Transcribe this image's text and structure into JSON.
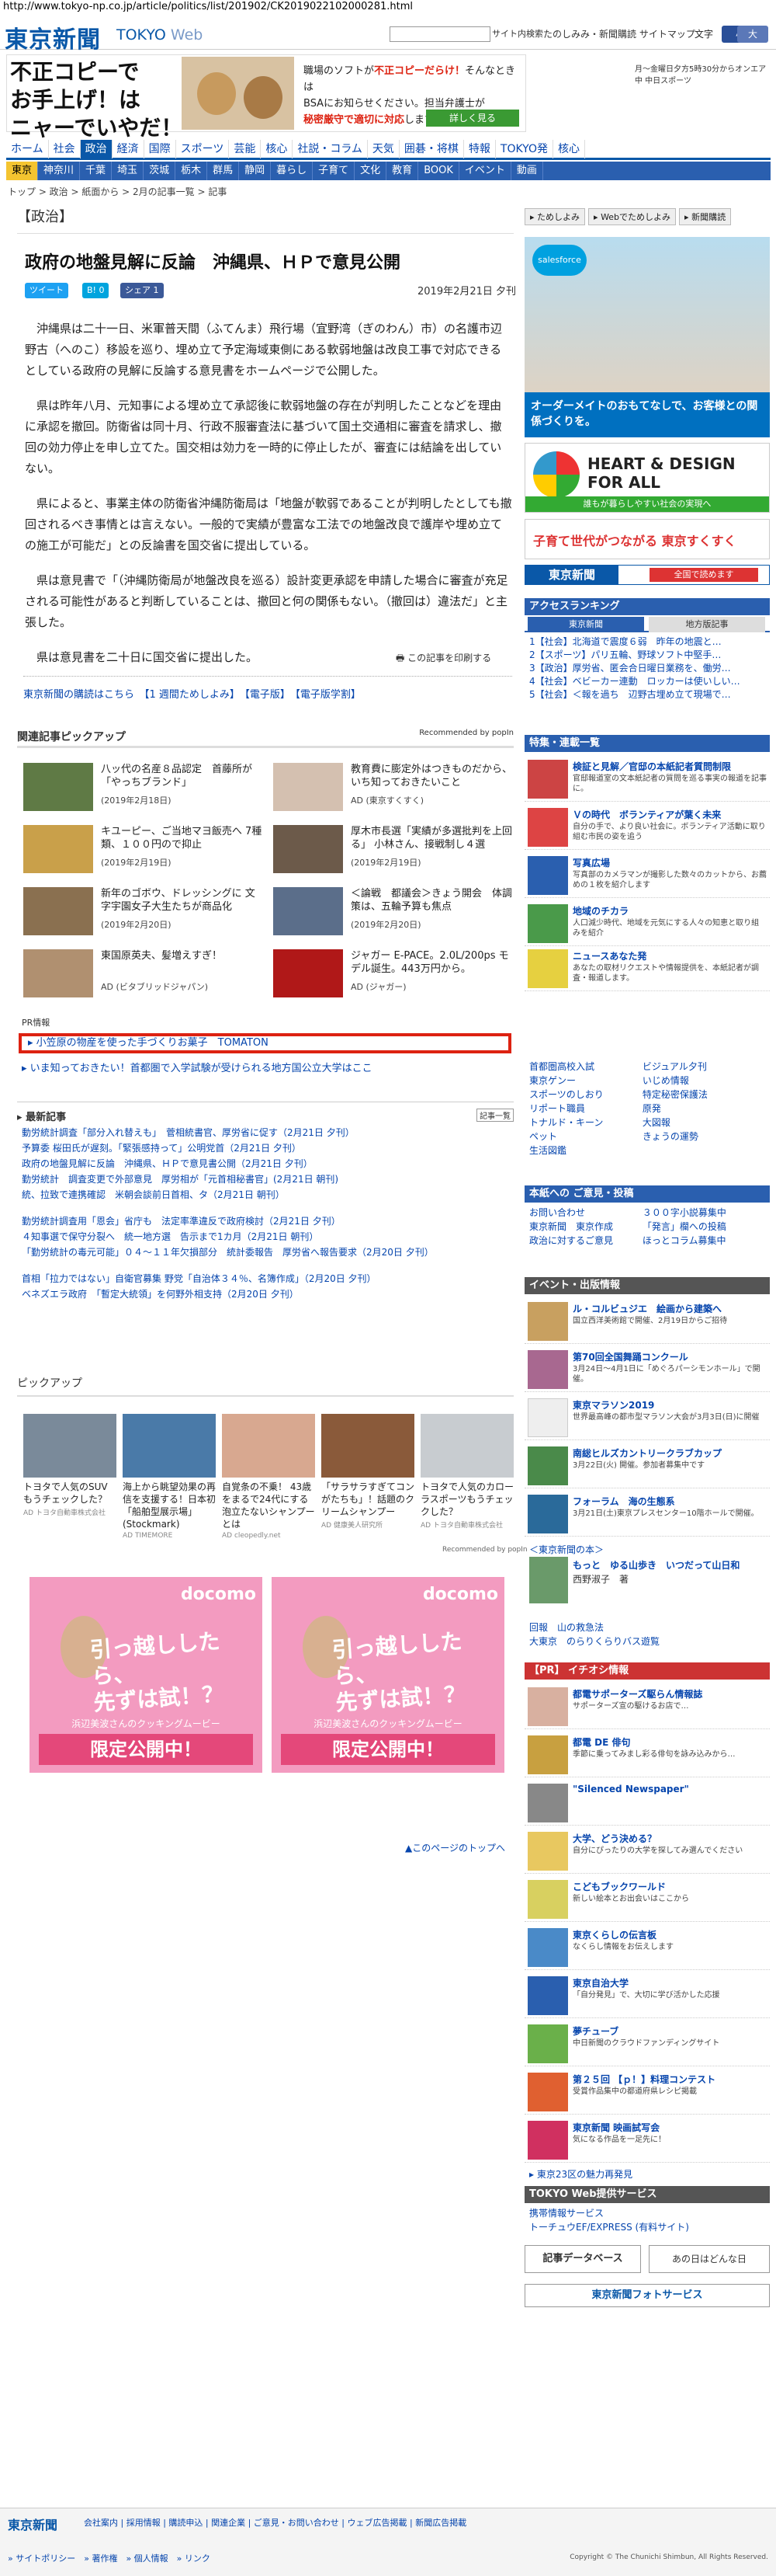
{
  "url": "http://www.tokyo-np.co.jp/article/politics/list/201902/CK2019022102000281.html",
  "header": {
    "logo": "東京新聞",
    "logo_sub": "TOKYO",
    "logo_web": "Web",
    "search_btn": "サイト内検索",
    "links": "たのしみみ・新聞購読 サイトマップ",
    "font": "文字",
    "font_small": "小",
    "font_big": "大"
  },
  "ad_top": {
    "headline1": "不正コピーで",
    "headline2": "お手上げ！は",
    "headline3": "ニャーでいやだ！",
    "text1": "職場のソフトが",
    "text_red": "不正コピーだらけ！",
    "text2": "そんなときは",
    "text3": "BSAにお知らせください。担当弁護士が",
    "text_red2": "秘密厳守で適切に対応",
    "text4": "します。",
    "btn": "詳しく見る",
    "banner": "月〜金曜日夕方5時30分からオンエア中 中日スポーツ"
  },
  "nav1": [
    "ホーム",
    "社会",
    "政治",
    "経済",
    "国際",
    "スポーツ",
    "芸能",
    "核心",
    "社説・コラム",
    "天気",
    "囲碁・将棋",
    "特報",
    "TOKYO発",
    "核心"
  ],
  "nav2": [
    "東京",
    "神奈川",
    "千葉",
    "埼玉",
    "茨城",
    "栃木",
    "群馬",
    "静岡",
    "暮らし",
    "子育て",
    "文化",
    "教育",
    "BOOK",
    "イベント",
    "動画"
  ],
  "breadcrumb": "トップ > 政治 > 紙面から > 2月の記事一覧 > 記事",
  "section": "【政治】",
  "article": {
    "title": "政府の地盤見解に反論　沖縄県、ＨＰで意見公開",
    "date": "2019年2月21日 夕刊",
    "tweet": "ツイート",
    "hatena": "0",
    "fb": "シェア 1",
    "p1": "沖縄県は二十一日、米軍普天間（ふてんま）飛行場（宜野湾（ぎのわん）市）の名護市辺野古（へのこ）移設を巡り、埋め立て予定海域東側にある軟弱地盤は改良工事で対応できるとしている政府の見解に反論する意見書をホームページで公開した。",
    "p2": "県は昨年八月、元知事による埋め立て承認後に軟弱地盤の存在が判明したことなどを理由に承認を撤回。防衛省は同十月、行政不服審査法に基づいて国土交通相に審査を請求し、撤回の効力停止を申し立てた。国交相は効力を一時的に停止したが、審査には結論を出していない。",
    "p3": "県によると、事業主体の防衛省沖縄防衛局は「地盤が軟弱であることが判明したとしても撤回されるべき事情とは言えない。一般的で実績が豊富な工法での地盤改良で護岸や埋め立ての施工が可能だ」との反論書を国交省に提出している。",
    "p4": "県は意見書で「（沖縄防衛局が地盤改良を巡る）設計変更承認を申請した場合に審査が充足される可能性があると判断していることは、撤回と何の関係もない。（撤回は）違法だ」と主張した。",
    "p5": "県は意見書を二十日に国交省に提出した。",
    "print": "この記事を印刷する"
  },
  "tags": "東京新聞の購読はこちら　【1 週間ためしよみ】　【電子版】　【電子版学割】",
  "related": {
    "title": "関連記事ピックアップ",
    "rec": "Recommended by popIn",
    "items": [
      {
        "t": "八ッ代の名産８品認定　首藤所が「やっちブランド」",
        "d": "(2019年2月18日)"
      },
      {
        "t": "教育費に膨定外はつきものだから、いち知っておきたいこと",
        "d": "AD (東京すくすく)"
      },
      {
        "t": "キユーピー、ご当地マヨ飯売へ 7種類、１００円ので抑止",
        "d": "(2019年2月19日)"
      },
      {
        "t": "厚木市長選「実績が多選批判を上回る」 小林さん、接戦制し４選",
        "d": "(2019年2月19日)"
      },
      {
        "t": "新年のゴボウ、ドレッシングに  文字宇園女子大生たちが商品化",
        "d": "(2019年2月20日)"
      },
      {
        "t": "＜論戦　都議会＞きょう開会　体調策は、五輪予算も焦点",
        "d": "(2019年2月20日)"
      },
      {
        "t": "東国原英夫、髪増えすぎ！",
        "d": "AD (ビタブリッドジャパン)"
      },
      {
        "t": "ジャガー E-PACE。2.0L/200ps モデル誕生。443万円から。",
        "d": "AD (ジャガー)"
      }
    ]
  },
  "pr": {
    "tag": "PR情報",
    "item1": "小笠原の物産を使った手づくりお菓子　TOMATON",
    "item2": "いま知っておきたい！首都圏で入学試験が受けられる地方国公立大学はここ"
  },
  "latest": {
    "title": "最新記事",
    "kiji": "記事一覧",
    "items": [
      "動労統計調査「部分入れ替えも」　菅相統書官、厚労省に促す（2月21日 夕刊）",
      "予算委 桜田氏が遅刻。「緊張感持って」公明党首（2月21日 夕刊）",
      "政府の地盤見解に反論　沖縄県、ＨＰで意見書公開（2月21日 夕刊）",
      "勤労統計　調査変更で外部意見　厚労相が「元首相秘書官」(2月21日 朝刊)",
      "統、拉致で連携確認　米朝会談前日首相、タ（2月21日 朝刊）",
      "",
      "勤労統計調査用「恩会」省庁も　法定率準違反で政府検討（2月21日 夕刊）",
      "４知事選で保守分裂へ　統一地方選　告示まで1カ月（2月21日 朝刊）",
      "「勤労統計の毒元可能」０４〜１１年欠損部分　統計委報告　厚労省へ報告要求（2月20日 夕刊）",
      "",
      "首相「拉力ではない」自衛官募集 野党「自治体３４％、名簿作成」（2月20日 夕刊）",
      "ベネズエラ政府　「暫定大統領」を何野外相支持（2月20日 夕刊）"
    ]
  },
  "pickup": {
    "title": "ピックアップ",
    "items": [
      {
        "t": "トヨタで人気のSUVもうチェックした？",
        "s": "AD トヨタ自動車株式会社"
      },
      {
        "t": "海上から眺望効果の再信を支援する！日本初「船舶型展示場」(Stockmark)",
        "s": "AD TIMEMORE"
      },
      {
        "t": "自覚条の不乗！ 43歳をまるで24代にする泡立たないシャンプーとは",
        "s": "AD cleopedly.net"
      },
      {
        "t": "「サラサラすぎてコンがたちも」！話題のクリームシャンプー",
        "s": "AD 健康美人研究所"
      },
      {
        "t": "トヨタで人気のカローラスポーツもうチェックした？",
        "s": "AD トヨタ自動車株式会社"
      }
    ],
    "rec": "Recommended by popIn"
  },
  "docomo": {
    "brand": "docomo",
    "big1": "引っ越ししたら、",
    "big2": "先ずは試！？",
    "sub": "浜辺美波さんのクッキングムービー",
    "btn": "限定公開中！"
  },
  "totop": "このページのトップへ",
  "side": {
    "btns": [
      "ためしよみ",
      "Webでためしよみ",
      "新聞購読"
    ],
    "ad1_label": "salesforce",
    "ad1_text": "オーダーメイトのおもてなしで、お客様との関係づくりを。",
    "heart": "HEART & DESIGN FOR ALL",
    "heart_sub": "誰もが暮らしやすい社会の実現へ",
    "suku": "子育て世代がつながる 東京すくすく",
    "shimbun": "東京新聞",
    "shimbun_btn": "全国で読めます",
    "access": "アクセスランキング",
    "tab1": "東京新聞",
    "tab2": "地方版記事",
    "rank": [
      "1【社会】北海道で震度６弱　昨年の地震と…",
      "2【スポーツ】パリ五輪、野球ソフト中堅手…",
      "3【政治】厚労省、匿会合日曜日業務を、働労…",
      "4【社会】ベビーカー連動　ロッカーは使いしい…",
      "5【社会】＜報を過ち　辺野古埋め立て現場で…"
    ],
    "special": "特集・連載一覧",
    "sitems": [
      {
        "t": "検証と見解／官邸の本紙記者質問制限",
        "d": "官邸報道室の文本紙記者の質問を巡る事実の報道を記事に。"
      },
      {
        "t": "Ｖの時代　ボランティアが葉く未来",
        "d": "自分の手で、より良い社会に。ボランティア活動に取り組む市民の姿を追う"
      },
      {
        "t": "写真広場",
        "d": "写真部のカメラマンが撮影した数々のカットから、お薦めの１枚を紹介します"
      },
      {
        "t": "地域のチカラ",
        "d": "人口減少時代、地域を元気にする人々の知恵と取り組みを紹介"
      },
      {
        "t": "ニュースあなた発",
        "d": "あなたの取材リクエストや情報提供を、本紙記者が調査・報道します。"
      }
    ],
    "links": [
      "首都圏高校入試",
      "ビジュアル夕刊",
      "東京ゲンー",
      "いじめ情報",
      "スポーツのしおり",
      "特定秘密保護法",
      "リポート職員",
      "原発",
      "トナルド・キーン",
      "大図報",
      "ペット",
      "きょうの運勢",
      "生活図鑑"
    ],
    "sub": "本紙への ご意見・投稿",
    "sublinks": [
      "お問い合わせ",
      "３００字小説募集中",
      "東京新聞　東京作成",
      "「発言」欄への投稿",
      "政治に対するご意見",
      "ほっとコラム募集中"
    ],
    "event": "イベント・出版情報",
    "events": [
      {
        "t": "ル・コルビュジエ　絵画から建築へ",
        "d": "国立西洋美術館で開催、2月19日からご招待"
      },
      {
        "t": "第70回全国舞踊コンクール",
        "d": "3月24日〜4月1日に「めぐろパーシモンホール」で開催。"
      },
      {
        "t": "東京マラソン2019",
        "d": "世界最高峰の都市型マラソン大会が3月3日(日)に開催"
      },
      {
        "t": "南総ヒルズカントリークラブカップ",
        "d": "3月22日(火) 開催。参加者募集中です"
      },
      {
        "t": "フォーラム　海の生態系",
        "d": "3月21日(土)東京プレスセンター10階ホールで開催。"
      }
    ],
    "book": "＜東京新聞の本＞",
    "book_item": "もっと　ゆる山歩き　いつだって山日和",
    "book_author": "西野淑子　著",
    "kairan": "回報　山の救急法",
    "kairan2": "大東京　のらりくらりバス遊覧",
    "pr": "【PR】 イチオシ情報",
    "pritems": [
      {
        "t": "都電サポーターズ駆らん情報誌",
        "d": "サポーターズ宣の駆けるお店で…"
      },
      {
        "t": "都電 DE 俳句",
        "d": "季節に乗ってみまし彩る俳句を詠み込みから…"
      },
      {
        "t": "\"Silenced Newspaper\"",
        "d": ""
      },
      {
        "t": "大学、どう決める？",
        "d": "自分にぴったりの大学を探してみ選んでください"
      },
      {
        "t": "こどもブックワールド",
        "d": "新しい絵本とお出会いはここから"
      },
      {
        "t": "東京くらしの伝言板",
        "d": "なくらし情報をお伝えします"
      },
      {
        "t": "東京自治大学",
        "d": "「自分発見」で、大切に学び活かした応援"
      },
      {
        "t": "夢チューブ",
        "d": "中日新聞のクラウドファンディングサイト"
      },
      {
        "t": "第２５回 【ｐ！】料理コンテスト",
        "d": "受賞作品集中の都道府県レシピ掲載"
      },
      {
        "t": "東京新聞 映画試写会",
        "d": "気になる作品を一足先に！"
      }
    ],
    "area": "東京23区の魅力再発見",
    "web": "TOKYO Web提供サービス",
    "web_links": [
      "携帯情報サービス",
      "トーチュウEF/EXPRESS (有料サイト)"
    ],
    "db": "記事データベース",
    "ad_link": "あの日はどんな日",
    "photo": "東京新聞フォトサービス"
  },
  "footer": {
    "logo": "東京新聞",
    "links": "会社案内 | 採用情報 | 購読申込 | 関連企業 | ご意見・お問い合わせ | ウェブ広告掲載 | 新聞広告掲載",
    "links2": "» サイトポリシー　» 著作権　» 個人情報　» リンク",
    "copy": "Copyright © The Chunichi Shimbun, All Rights Reserved."
  }
}
